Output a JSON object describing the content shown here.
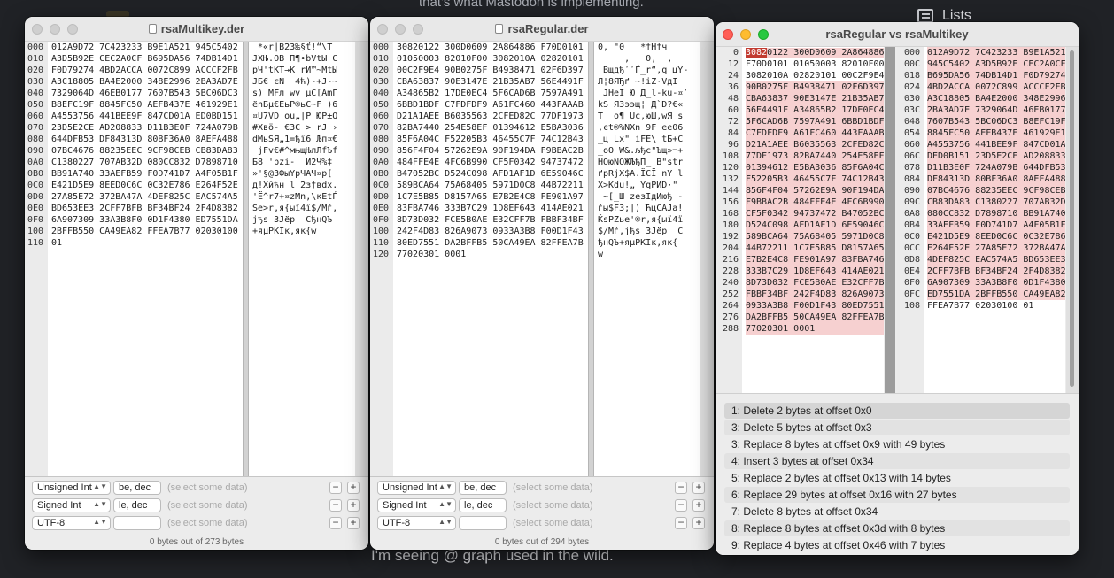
{
  "background": {
    "top_text": "that's what Mastodon is implementing.",
    "bottom_text": "I'm seeing @ graph used in the wild.",
    "lists_label": "Lists"
  },
  "win1": {
    "title": "rsaMultikey.der",
    "offsets": [
      "000",
      "010",
      "020",
      "030",
      "040",
      "050",
      "060",
      "070",
      "080",
      "090",
      "0A0",
      "0B0",
      "0C0",
      "0D0",
      "0E0",
      "0F0",
      "100",
      "110"
    ],
    "hex": [
      "012A9D72 7C423233 B9E1A521 945C5402",
      "A3D5B92E CEC2A0CF B695DA56 74DB14D1",
      "F0D79274 4BD2ACCA 0072C899 ACCCF2FB",
      "A3C18805 BA4E2000 348E2996 2BA3AD7E",
      "7329064D 46EB0177 7607B543 5BC06DC3",
      "B8EFC19F 8845FC50 AEFB437E 461929E1",
      "A4553756 441BEE9F 847CD01A ED0BD151",
      "23D5E2CE AD208833 D11B3E0F 724A079B",
      "644DFB53 DF84313D 80BF36A0 8AEFA488",
      "07BC4676 88235EEC 9CF98CEB CB83DA83",
      "C1380227 707AB32D 080CC832 D7898710",
      "BB91A740 33AEFB59 F0D741D7 A4F05B1F",
      "E421D5E9 8EED0C6C 0C32E786 E264F52E",
      "27A85E72 372BA47A 4DEF825C EAC574A5",
      "BD653EE3 2CFF7BFB BF34BF24 2F4D8382",
      "6A907309 33A3B8F0 0D1F4380 ED7551DA",
      "2BFFB550 CA49EA82 FFEA7B77 02030100",
      "01"
    ],
    "text": [
      " *«r|B23‰§ť!“\\T",
      "JXЊ.OB П¶•bVtЫ C",
      "рЧ'tKT→K rИ™~MtЫ",
      "JБ€ єN  4ћ)-+J-~",
      "s) MFл wv µС[AmГ",
      "ёnБµ€EьP®ьC~F )6",
      "¤U7VD ou„|P ЮP±Q",
      "#Xвӧ- €3C > rJ ›",
      "dMьSЯ„1=ђї6 Љп¤€",
      " jFv€#^мњщЊлЛfЪf",
      "Б8 'pzi-  И2Ч%‡",
      "»'§@3ФыYрЧАЧ¤р[",
      "д!Хйћн l 2з†вdx.",
      "'Ё^r7+¤zMn,\\кEtЃ",
      "Se>r,я{ыї4ї$/Mѓ,",
      "jђs 3Jёр  СђнQЪ",
      "+яµPKIк,як{w",
      ""
    ],
    "inspector": [
      {
        "type": "Unsigned Int",
        "endian": "be, dec",
        "value": "(select some data)"
      },
      {
        "type": "Signed Int",
        "endian": "le, dec",
        "value": "(select some data)"
      },
      {
        "type": "UTF-8",
        "endian": "",
        "value": "(select some data)"
      }
    ],
    "status": "0 bytes out of 273 bytes"
  },
  "win2": {
    "title": "rsaRegular.der",
    "offsets": [
      "000",
      "010",
      "020",
      "030",
      "040",
      "050",
      "060",
      "070",
      "080",
      "090",
      "0A0",
      "0B0",
      "0C0",
      "0D0",
      "0E0",
      "0F0",
      "100",
      "110",
      "120"
    ],
    "hex": [
      "30820122 300D0609 2A864886 F70D0101",
      "01050003 82010F00 3082010A 02820101",
      "00C2F9E4 90B0275F B4938471 02F6D397",
      "CBA63837 90E3147E 21B35AB7 56E4491F",
      "A34865B2 17DE0EC4 5F6CAD6B 7597A491",
      "6BBD1BDF C7FDFDF9 A61FC460 443FAAAB",
      "D21A1AEE B6035563 2CFED82C 77DF1973",
      "82BA7440 254E58EF 01394612 E5BA3036",
      "85F6A04C F52205B3 46455C7F 74C12B43",
      "856F4F04 57262E9A 90F194DA F9BBAC2B",
      "484FFE4E 4FC6B990 CF5F0342 94737472",
      "B47052BC D524C098 AFD1AF1D 6E59046C",
      "589BCA64 75A68405 5971D0C8 44B72211",
      "1C7E5B85 D8157A65 E7B2E4C8 FE901A97",
      "83FBA746 333B7C29 1D8EF643 414AE021",
      "8D73D032 FCE5B0AE E32CFF7B FBBF34BF",
      "242F4D83 826A9073 0933A3B8 F00D1F43",
      "80ED7551 DA2BFFB5 50CA49EA 82FFEA7B",
      "77020301 0001"
    ],
    "text": [
      "0‚ \"0   *†H†ч",
      "     ‚   0‚  ‚",
      " ВщдђʹʹЃ_r“‚q цY-",
      "Л¦8ЯЂґ ~!іZ·VдI",
      " JНеI Ю Д_l-ku-¤ʹ",
      "kЅ ЯЗээщ¦ Д`D?€«",
      "T  о¶ Uc‚юШ‚wЯ s",
      ",єt®%NXn 9F ee06",
      "_ц Lx\" iFE\\ tБ+C",
      "_oO W&.љђс\"Ъщ»¬+",
      "HOюNOЖЉђП_ B\"str",
      "ґрRjX$A.ЇСЇ nY l",
      "X>Kdu!„ YqPИD·\"",
      " ~[_Ш zезIдИюђ -",
      "ѓы$F3;|) ЋцCAJа!",
      "ЌsPZье'®r,я{ыї4ї",
      "$/Mѓ,јђs 3Jёр  С",
      "ђнQЪ+яµPKIк,як{",
      "w"
    ],
    "inspector": [
      {
        "type": "Unsigned Int",
        "endian": "be, dec",
        "value": "(select some data)"
      },
      {
        "type": "Signed Int",
        "endian": "le, dec",
        "value": "(select some data)"
      },
      {
        "type": "UTF-8",
        "endian": "",
        "value": "(select some data)"
      }
    ],
    "status": "0 bytes out of 294 bytes"
  },
  "compare": {
    "title": "rsaRegular vs rsaMultikey",
    "left_offsets": [
      "0",
      "12",
      "24",
      "36",
      "48",
      "60",
      "72",
      "84",
      "96",
      "108",
      "120",
      "132",
      "144",
      "156",
      "168",
      "180",
      "192",
      "204",
      "216",
      "228",
      "240",
      "252",
      "264",
      "276",
      "288"
    ],
    "left_hex": [
      "30820122 300D0609 2A864886",
      "F70D0101 01050003 82010F00",
      "3082010A 02820101 00C2F9E4",
      "90B0275F B4938471 02F6D397",
      "CBA63837 90E3147E 21B35AB7",
      "56E4491F A34865B2 17DE0EC4",
      "5F6CAD6B 7597A491 6BBD1BDF",
      "C7FDFDF9 A61FC460 443FAAAB",
      "D21A1AEE B6035563 2CFED82C",
      "77DF1973 82BA7440 254E58EF",
      "01394612 E5BA3036 85F6A04C",
      "F52205B3 46455C7F 74C12B43",
      "856F4F04 57262E9A 90F194DA",
      "F9BBAC2B 484FFE4E 4FC6B990",
      "CF5F0342 94737472 B47052BC",
      "D524C098 AFD1AF1D 6E59046C",
      "589BCA64 75A68405 5971D0C8",
      "44B72211 1C7E5B85 D8157A65",
      "E7B2E4C8 FE901A97 83FBA746",
      "333B7C29 1D8EF643 414AE021",
      "8D73D032 FCE5B0AE E32CFF7B",
      "FBBF34BF 242F4D83 826A9073",
      "0933A3B8 F00D1F43 80ED7551",
      "DA2BFFB5 50CA49EA 82FFEA7B",
      "77020301 0001"
    ],
    "right_offsets": [
      "000",
      "00C",
      "018",
      "024",
      "030",
      "03C",
      "048",
      "054",
      "060",
      "06C",
      "078",
      "084",
      "090",
      "09C",
      "0A8",
      "0B4",
      "0C0",
      "0CC",
      "0D8",
      "0E4",
      "0F0",
      "0FC",
      "108"
    ],
    "right_hex": [
      "012A9D72 7C423233 B9E1A521",
      "945C5402 A3D5B92E CEC2A0CF",
      "B695DA56 74DB14D1 F0D79274",
      "4BD2ACCA 0072C899 ACCCF2FB",
      "A3C18805 BA4E2000 348E2996",
      "2BA3AD7E 7329064D 46EB0177",
      "7607B543 5BC06DC3 B8EFC19F",
      "8845FC50 AEFB437E 461929E1",
      "A4553756 441BEE9F 847CD01A",
      "DED0B151 23D5E2CE AD208833",
      "D11B3E0F 724A079B 644DFB53",
      "DF84313D 80BF36A0 8AEFA488",
      "07BC4676 88235EEC 9CF98CEB",
      "CB83DA83 C1380227 707AB32D",
      "080CC832 D7898710 BB91A740",
      "33AEFB59 F0D741D7 A4F05B1F",
      "E421D5E9 8EED0C6C 0C32E786",
      "E264F52E 27A85E72 372BA47A",
      "4DEF825C EAC574A5 BD653EE3",
      "2CFF7BFB BF34BF24 2F4D8382",
      "6A907309 33A3B8F0 0D1F4380",
      "ED7551DA 2BFFB550 CA49EA82",
      "FFEA7B77 02030100 01"
    ],
    "changes": [
      "1: Delete 2 bytes at offset 0x0",
      "3: Delete 5 bytes at offset 0x3",
      "3: Replace 8 bytes at offset 0x9 with 49 bytes",
      "4: Insert 3 bytes at offset 0x34",
      "5: Replace 2 bytes at offset 0x13 with 14 bytes",
      "6: Replace 29 bytes at offset 0x16 with 27 bytes",
      "7: Delete 8 bytes at offset 0x34",
      "8: Replace 8 bytes at offset 0x3d with 8 bytes",
      "9: Replace 4 bytes at offset 0x46 with 7 bytes"
    ]
  }
}
